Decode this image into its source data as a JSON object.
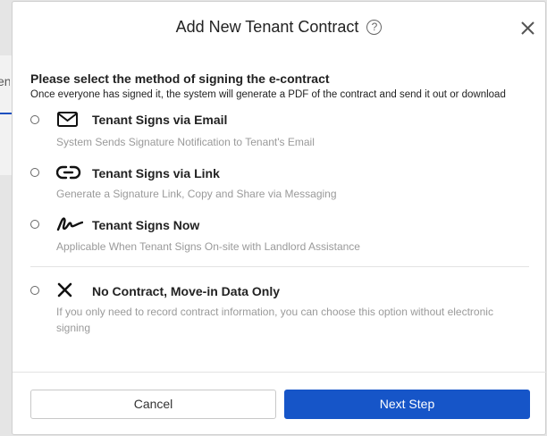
{
  "background": {
    "tab_text": "en"
  },
  "modal": {
    "title": "Add New Tenant Contract",
    "help_icon_glyph": "?",
    "close_icon": "close-icon"
  },
  "section": {
    "heading": "Please select the method of signing the e-contract",
    "description": "Once everyone has signed it, the system will generate a PDF of the contract and send it out or download"
  },
  "options": [
    {
      "icon": "envelope-icon",
      "label": "Tenant Signs via Email",
      "description": "System Sends Signature Notification to Tenant's Email",
      "selected": false
    },
    {
      "icon": "link-icon",
      "label": "Tenant Signs via Link",
      "description": "Generate a Signature Link, Copy and Share via Messaging",
      "selected": false
    },
    {
      "icon": "signature-icon",
      "label": "Tenant Signs Now",
      "description": "Applicable When Tenant Signs On-site with Landlord Assistance",
      "selected": false
    },
    {
      "icon": "x-icon",
      "label": "No Contract, Move-in Data Only",
      "description": "If you only need to record contract information, you can choose this option without electronic signing",
      "selected": false
    }
  ],
  "footer": {
    "cancel_label": "Cancel",
    "next_label": "Next Step"
  },
  "colors": {
    "primary": "#1655c8",
    "muted_text": "#9a9a9a"
  }
}
